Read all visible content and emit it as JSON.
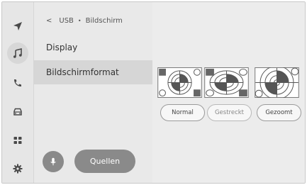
{
  "rail": {
    "items": [
      {
        "name": "navigation-icon",
        "active": false
      },
      {
        "name": "music-note-icon",
        "active": true
      },
      {
        "name": "phone-icon",
        "active": false
      },
      {
        "name": "car-icon",
        "active": false
      },
      {
        "name": "apps-grid-icon",
        "active": false
      },
      {
        "name": "settings-gear-icon",
        "active": false
      }
    ]
  },
  "breadcrumb": {
    "back": "<",
    "source": "USB",
    "separator": "•",
    "page": "Bildschirm"
  },
  "menu": {
    "items": [
      {
        "label": "Display",
        "selected": false
      },
      {
        "label": "Bildschirmformat",
        "selected": true
      }
    ]
  },
  "footer": {
    "mic_icon": "microphone-icon",
    "sources_label": "Quellen"
  },
  "formats": {
    "options": [
      {
        "label": "Normal",
        "enabled": true
      },
      {
        "label": "Gestreckt",
        "enabled": false
      },
      {
        "label": "Gezoomt",
        "enabled": true
      }
    ]
  },
  "colors": {
    "rail_bg": "#e6e6e6",
    "menu_bg": "#e9e9e9",
    "selected_bg": "#d6d6d6",
    "button_gray": "#8a8a8a"
  }
}
